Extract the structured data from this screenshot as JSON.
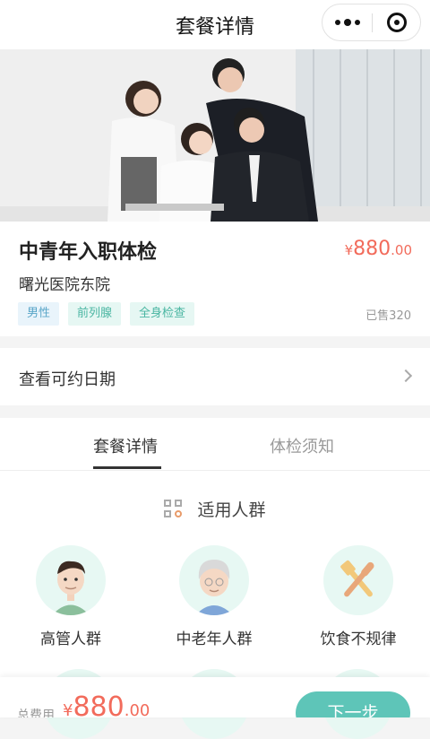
{
  "nav": {
    "title": "套餐详情"
  },
  "package": {
    "name": "中青年入职体检",
    "price": {
      "currency": "¥",
      "integer": "880",
      "decimal": ".00"
    },
    "hospital": "曙光医院东院",
    "tags": [
      "男性",
      "前列腺",
      "全身检查"
    ],
    "sold": "已售320"
  },
  "date_row": {
    "label": "查看可约日期"
  },
  "tabs": [
    "套餐详情",
    "体检须知"
  ],
  "section": {
    "title": "适用人群",
    "groups": [
      {
        "label": "高管人群",
        "icon": "executive-avatar-icon"
      },
      {
        "label": "中老年人群",
        "icon": "elderly-avatar-icon"
      },
      {
        "label": "饮食不规律",
        "icon": "fork-knife-icon"
      }
    ]
  },
  "bottom": {
    "total_label": "总费用",
    "total": {
      "currency": "¥",
      "integer": "880",
      "decimal": ".00"
    },
    "next_label": "下一步"
  },
  "colors": {
    "accent": "#5ec5b8",
    "price": "#f26b5b",
    "tag_blue": "#5aa6c8",
    "tag_green": "#4ab6a2"
  }
}
